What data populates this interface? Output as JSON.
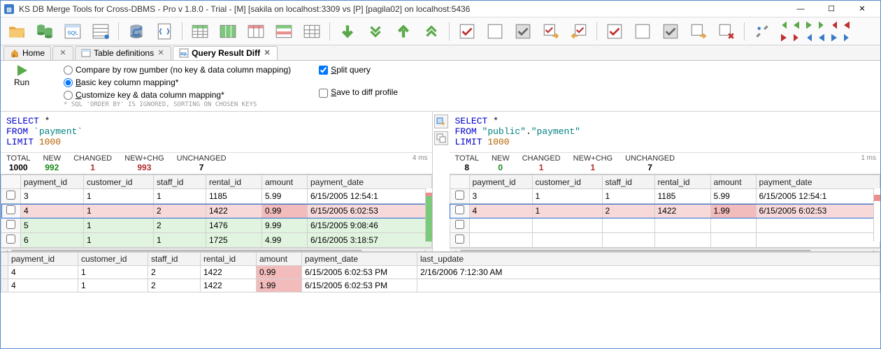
{
  "title": "KS DB Merge Tools for Cross-DBMS - Pro v 1.8.0 - Trial - [M] [sakila on localhost:3309 vs [P] [pagila02] on localhost:5436",
  "tabs": {
    "home": "Home",
    "tdef": "Table definitions",
    "qrd": "Query Result Diff"
  },
  "options": {
    "run": "Run",
    "r1_a": "Compare by row ",
    "r1_b": "n",
    "r1_c": "umber (no key & data column mapping)",
    "r2_a": "B",
    "r2_b": "asic key column mapping*",
    "r3_a": "C",
    "r3_b": "ustomize key & data column mapping*",
    "hint": "* SQL 'ORDER BY' IS IGNORED, SORTING ON CHOSEN KEYS",
    "c1_a": "S",
    "c1_b": "plit query",
    "c2_a": "S",
    "c2_b": "ave to diff profile"
  },
  "sql_left": {
    "l1_a": "SELECT",
    "l1_b": " *",
    "l2_a": "FROM ",
    "l2_b": "`payment`",
    "l3_a": "LIMIT ",
    "l3_b": "1000"
  },
  "sql_right": {
    "l1_a": "SELECT",
    "l1_b": " *",
    "l2_a": "FROM ",
    "l2_b": "\"public\"",
    "l2_c": ".",
    "l2_d": "\"payment\"",
    "l3_a": "LIMIT ",
    "l3_b": "1000"
  },
  "stats_labels": {
    "total": "TOTAL",
    "new": "NEW",
    "changed": "CHANGED",
    "newchg": "NEW+CHG",
    "unchanged": "UNCHANGED"
  },
  "stats_left": {
    "total": "1000",
    "new": "992",
    "changed": "1",
    "newchg": "993",
    "unchanged": "7",
    "ms": "4 ms"
  },
  "stats_right": {
    "total": "8",
    "new": "0",
    "changed": "1",
    "newchg": "1",
    "unchanged": "7",
    "ms": "1 ms"
  },
  "cols": {
    "c0": "",
    "c1": "payment_id",
    "c2": "customer_id",
    "c3": "staff_id",
    "c4": "rental_id",
    "c5": "amount",
    "c6": "payment_date"
  },
  "left_rows": [
    {
      "cls": "",
      "c1": "3",
      "c2": "1",
      "c3": "1",
      "c4": "1185",
      "c5": "5.99",
      "c6": "6/15/2005 12:54:1"
    },
    {
      "cls": "row-chg selected",
      "c1": "4",
      "c2": "1",
      "c3": "2",
      "c4": "1422",
      "c5": "0.99",
      "c6": "6/15/2005 6:02:53",
      "diff": "c5"
    },
    {
      "cls": "row-new",
      "c1": "5",
      "c2": "1",
      "c3": "2",
      "c4": "1476",
      "c5": "9.99",
      "c6": "6/15/2005 9:08:46"
    },
    {
      "cls": "row-new",
      "c1": "6",
      "c2": "1",
      "c3": "1",
      "c4": "1725",
      "c5": "4.99",
      "c6": "6/16/2005 3:18:57"
    }
  ],
  "right_rows": [
    {
      "cls": "",
      "c1": "3",
      "c2": "1",
      "c3": "1",
      "c4": "1185",
      "c5": "5.99",
      "c6": "6/15/2005 12:54:1"
    },
    {
      "cls": "row-chg selected",
      "c1": "4",
      "c2": "1",
      "c3": "2",
      "c4": "1422",
      "c5": "1.99",
      "c6": "6/15/2005 6:02:53",
      "diff": "c5"
    },
    {
      "cls": "",
      "c1": "",
      "c2": "",
      "c3": "",
      "c4": "",
      "c5": "",
      "c6": ""
    },
    {
      "cls": "",
      "c1": "",
      "c2": "",
      "c3": "",
      "c4": "",
      "c5": "",
      "c6": ""
    }
  ],
  "bottom_cols": {
    "c1": "payment_id",
    "c2": "customer_id",
    "c3": "staff_id",
    "c4": "rental_id",
    "c5": "amount",
    "c6": "payment_date",
    "c7": "last_update"
  },
  "bottom_rows": [
    {
      "c1": "4",
      "c2": "1",
      "c3": "2",
      "c4": "1422",
      "c5": "0.99",
      "c6": "6/15/2005 6:02:53 PM",
      "c7": "2/16/2006 7:12:30 AM"
    },
    {
      "c1": "4",
      "c2": "1",
      "c3": "2",
      "c4": "1422",
      "c5": "1.99",
      "c6": "6/15/2005 6:02:53 PM",
      "c7": ""
    }
  ]
}
